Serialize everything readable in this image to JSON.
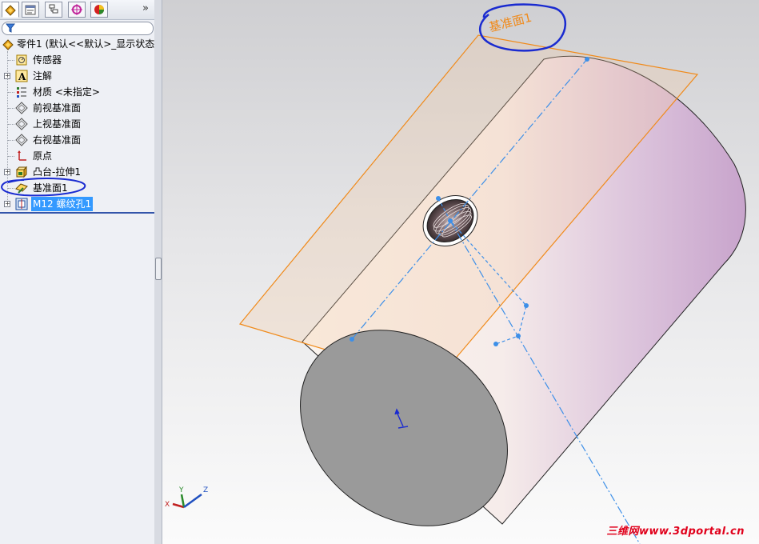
{
  "feature_manager": {
    "tabs": [
      {
        "name": "featuremanager-tab",
        "icon": "featuremanager-icon",
        "active": true
      },
      {
        "name": "propertymanager-tab",
        "icon": "propertymanager-icon",
        "active": false
      },
      {
        "name": "configurationmanager-tab",
        "icon": "configuration-icon",
        "active": false
      },
      {
        "name": "dimxpert-tab",
        "icon": "dimxpert-icon",
        "active": false
      },
      {
        "name": "display-manager-tab",
        "icon": "display-manager-icon",
        "active": false
      }
    ],
    "overflow_label": "»",
    "filter_placeholder": "",
    "tree": {
      "root_label": "零件1  (默认<<默认>_显示状态",
      "items": [
        {
          "label": "传感器",
          "icon": "sensor-icon",
          "expandable": false
        },
        {
          "label": "注解",
          "icon": "annotation-icon",
          "expandable": true
        },
        {
          "label": "材质 <未指定>",
          "icon": "material-icon",
          "expandable": false
        },
        {
          "label": "前视基准面",
          "icon": "plane-icon",
          "expandable": false
        },
        {
          "label": "上视基准面",
          "icon": "plane-icon",
          "expandable": false
        },
        {
          "label": "右视基准面",
          "icon": "plane-icon",
          "expandable": false
        },
        {
          "label": "原点",
          "icon": "origin-icon",
          "expandable": false
        },
        {
          "label": "凸台-拉伸1",
          "icon": "extrude-icon",
          "expandable": true
        },
        {
          "label": "基准面1",
          "icon": "plane-feature-icon",
          "expandable": false,
          "circled": true
        },
        {
          "label": "M12 螺纹孔1",
          "icon": "hole-wizard-icon",
          "expandable": true,
          "selected": true
        }
      ]
    }
  },
  "viewport": {
    "plane_label": "基准面1",
    "triad_labels": {
      "x": "X",
      "y": "Y",
      "z": "Z"
    },
    "watermark": "三维网www.3dportal.cn",
    "colors": {
      "plane_edge": "#f08a1a",
      "annotation": "#1a2bd0",
      "sketch": "#3d8fe8",
      "cylinder_end": "#9a9a9a"
    }
  }
}
